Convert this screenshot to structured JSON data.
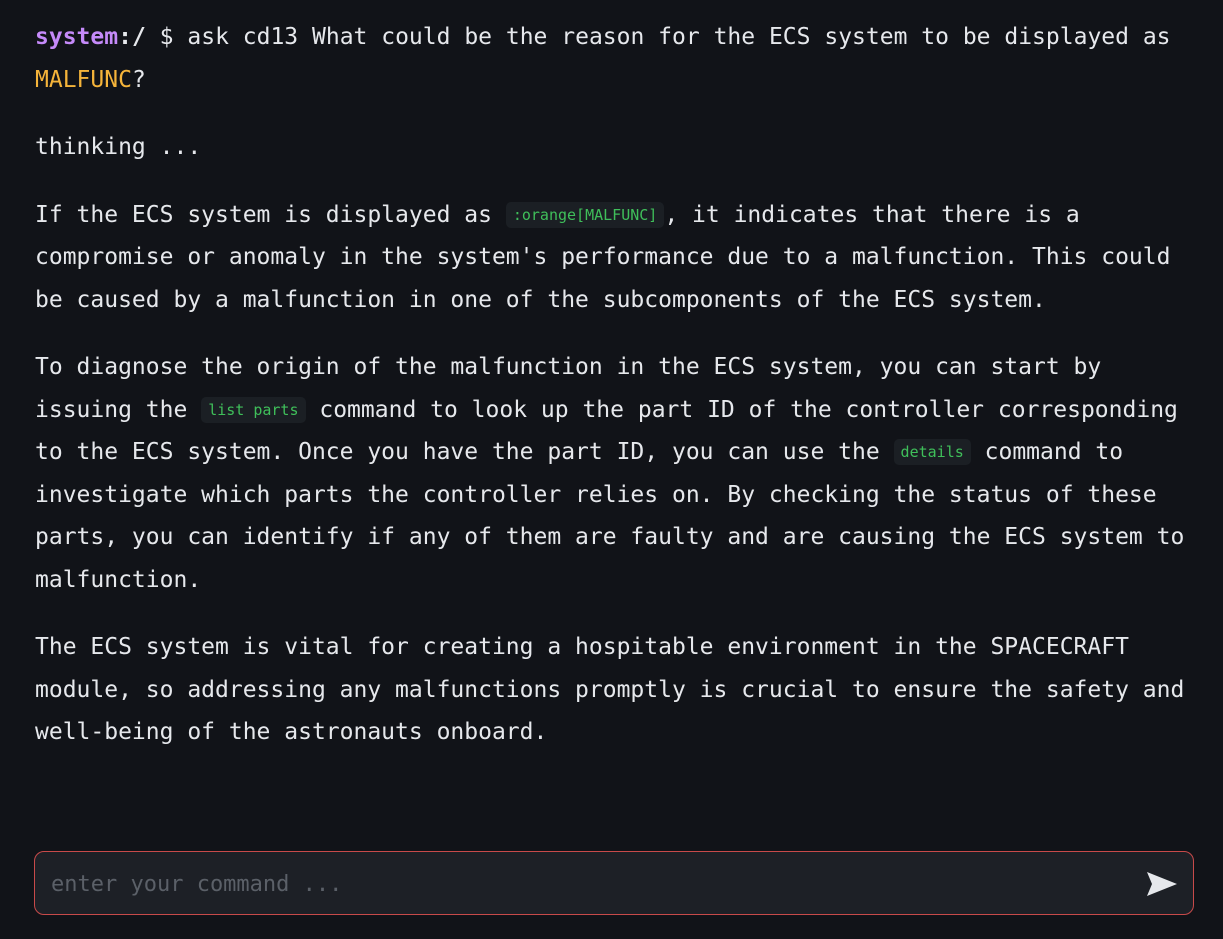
{
  "prompt": {
    "user": "system",
    "path": ":/",
    "symbol": "$",
    "command_before": "ask cd13 What could be the reason for the ECS system to be displayed as",
    "command_highlight": "MALFUNC",
    "command_after": "?"
  },
  "status": "thinking ...",
  "response": {
    "p1_before": "If the ECS system is displayed as",
    "p1_code": ":orange[MALFUNC]",
    "p1_after": ", it indicates that there is a compromise or anomaly in the system's performance due to a malfunction. This could be caused by a malfunction in one of the subcomponents of the ECS system.",
    "p2_a": "To diagnose the origin of the malfunction in the ECS system, you can start by issuing the",
    "p2_code1": "list parts",
    "p2_b": "command to look up the part ID of the controller corresponding to the ECS system. Once you have the part ID, you can use the",
    "p2_code2": "details",
    "p2_c": "command to investigate which parts the controller relies on. By checking the status of these parts, you can identify if any of them are faulty and are causing the ECS system to malfunction.",
    "p3": "The ECS system is vital for creating a hospitable environment in the SPACECRAFT module, so addressing any malfunctions promptly is crucial to ensure the safety and well-being of the astronauts onboard."
  },
  "input": {
    "placeholder": "enter your command ...",
    "value": ""
  },
  "icons": {
    "send": "send-arrow-icon"
  },
  "colors": {
    "background": "#111318",
    "prompt_user": "#c58af9",
    "highlight_orange": "#f5b43a",
    "code_text": "#3fbf5a",
    "input_border": "#c84a4a"
  }
}
